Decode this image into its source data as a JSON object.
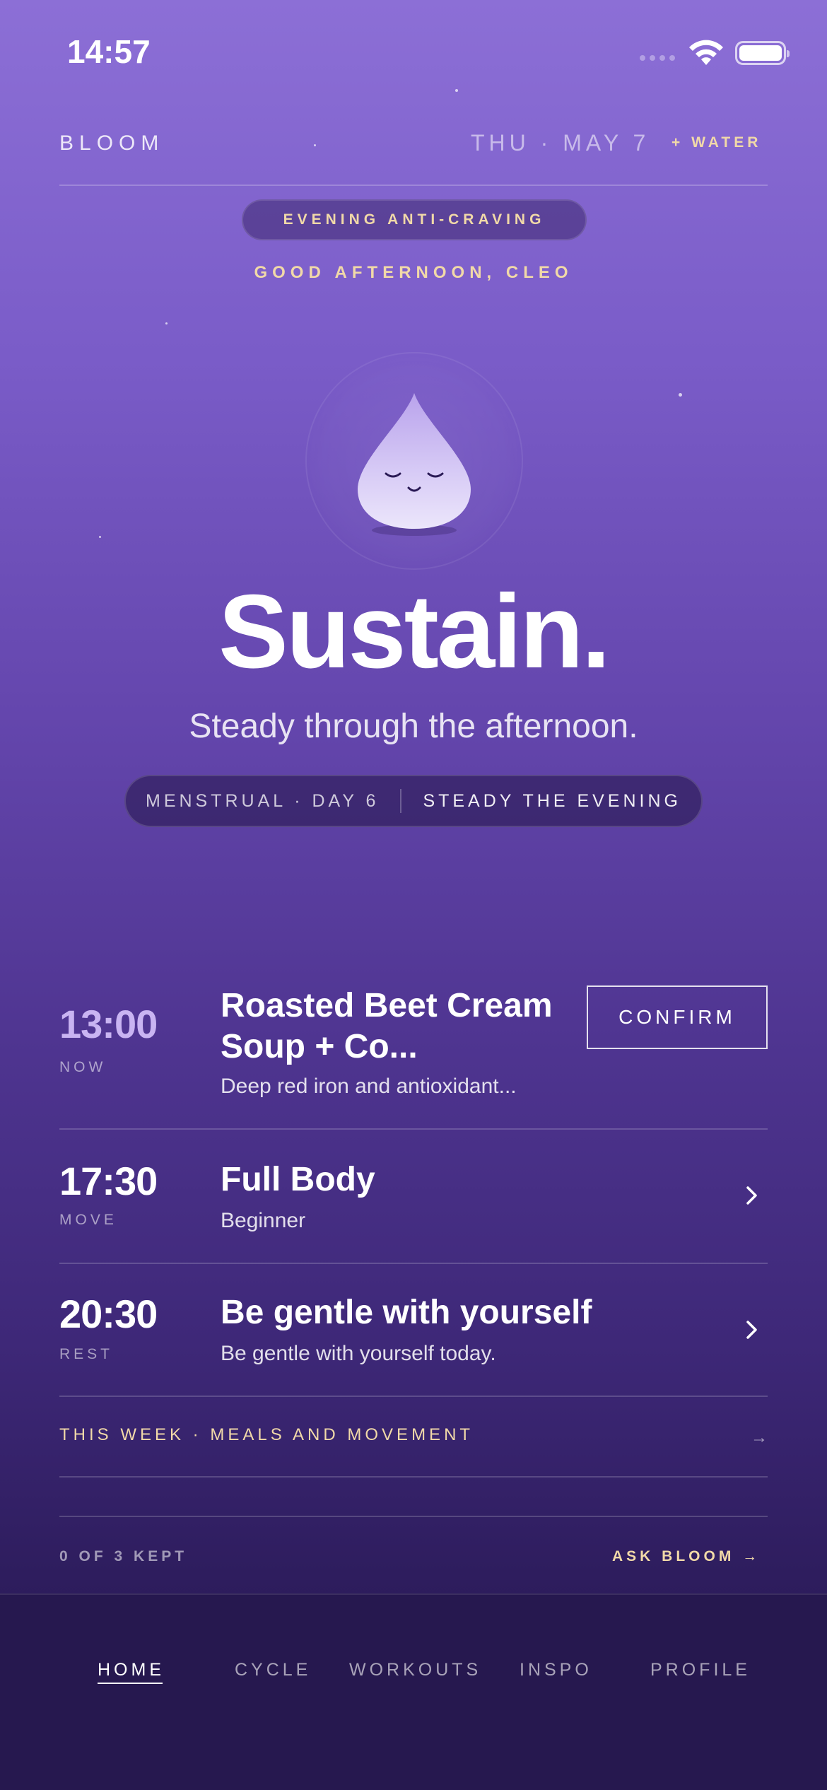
{
  "status_bar": {
    "time": "14:57"
  },
  "header": {
    "brand": "BLOOM",
    "date": "THU · MAY 7",
    "water_label": "+ WATER"
  },
  "mode_pill": "EVENING ANTI-CRAVING",
  "greeting": "GOOD AFTERNOON, CLEO",
  "hero": {
    "title": "Sustain.",
    "subtitle": "Steady through the afternoon."
  },
  "phase": {
    "cycle": "MENSTRUAL · DAY 6",
    "goal": "STEADY THE EVENING"
  },
  "schedule": [
    {
      "time": "13:00",
      "tag": "NOW",
      "title": "Roasted Beet Cream Soup + Co...",
      "description": "Deep red iron and antioxidant...",
      "action_label": "CONFIRM"
    },
    {
      "time": "17:30",
      "tag": "MOVE",
      "title": "Full Body",
      "description": "Beginner"
    },
    {
      "time": "20:30",
      "tag": "REST",
      "title": "Be gentle with yourself",
      "description": "Be gentle with yourself today."
    }
  ],
  "week_link": {
    "label": "THIS WEEK · MEALS AND MOVEMENT",
    "arrow": "→"
  },
  "footer": {
    "kept": "0 OF 3 KEPT",
    "ask": "ASK BLOOM →"
  },
  "tabs": [
    {
      "label": "HOME",
      "active": true
    },
    {
      "label": "CYCLE",
      "active": false
    },
    {
      "label": "WORKOUTS",
      "active": false
    },
    {
      "label": "INSPO",
      "active": false
    },
    {
      "label": "PROFILE",
      "active": false
    }
  ],
  "colors": {
    "accent_gold": "#f1d9a8",
    "time_now": "#c9b4f2",
    "tabbar_bg": "#26184f"
  }
}
